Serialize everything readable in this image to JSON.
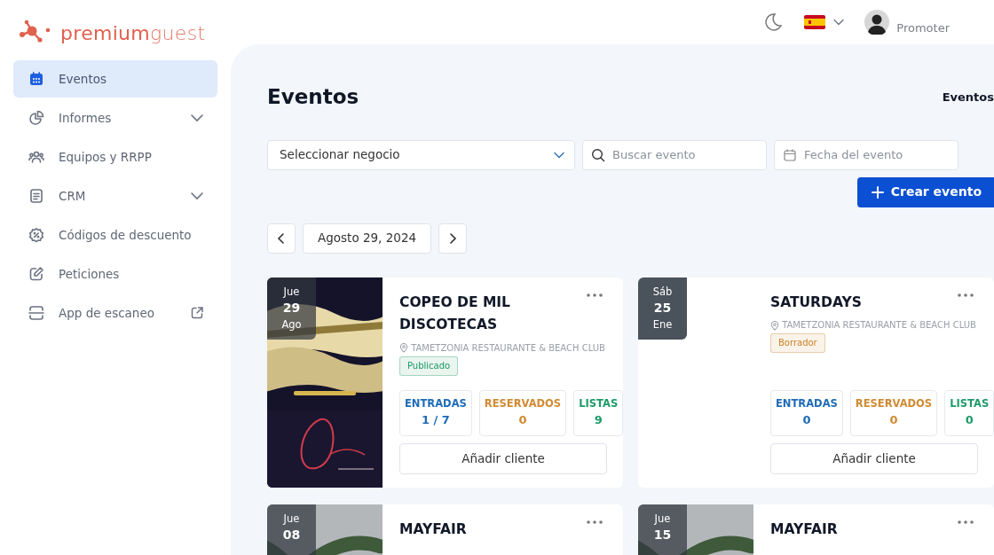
{
  "brand": {
    "name_bold": "premium",
    "name_light": "guest"
  },
  "sidebar": {
    "items": [
      {
        "label": "Eventos",
        "selected": true,
        "has_submenu": false,
        "external": false
      },
      {
        "label": "Informes",
        "selected": false,
        "has_submenu": true,
        "external": false
      },
      {
        "label": "Equipos y RRPP",
        "selected": false,
        "has_submenu": false,
        "external": false
      },
      {
        "label": "CRM",
        "selected": false,
        "has_submenu": true,
        "external": false
      },
      {
        "label": "Códigos de descuento",
        "selected": false,
        "has_submenu": false,
        "external": false
      },
      {
        "label": "Peticiones",
        "selected": false,
        "has_submenu": false,
        "external": false
      },
      {
        "label": "App de escaneo",
        "selected": false,
        "has_submenu": false,
        "external": true
      }
    ]
  },
  "header": {
    "role": "Promoter"
  },
  "page": {
    "title": "Eventos",
    "breadcrumb": "Eventos"
  },
  "filters": {
    "business_select": "Seleccionar negocio",
    "search": {
      "placeholder": "Buscar evento"
    },
    "date": {
      "placeholder": "Fecha del evento"
    }
  },
  "create_button": "Crear evento",
  "date_nav": {
    "date": "Agosto 29, 2024"
  },
  "events": [
    {
      "day_name": "Jue",
      "day": "29",
      "month": "Ago",
      "has_picture": true,
      "title": "COPEO DE MIL DISCOTECAS",
      "venue": "TAMETZONIA RESTAURANTE & BEACH CLUB",
      "status": "Publicado",
      "color": "#1b9a63",
      "stats": [
        {
          "label": "ENTRADAS",
          "value": "1 / 7",
          "kind": "tickets"
        },
        {
          "label": "RESERVADOS",
          "value": "0",
          "kind": "reserved"
        },
        {
          "label": "LISTAS",
          "value": "9",
          "kind": "lists"
        }
      ],
      "action": "Añadir cliente"
    },
    {
      "day_name": "Sáb",
      "day": "25",
      "month": "Ene",
      "has_picture": false,
      "title": "SATURDAYS",
      "venue": "TAMETZONIA RESTAURANTE & BEACH CLUB",
      "status": "Borrador",
      "color": "#cc7f23",
      "stats": [
        {
          "label": "ENTRADAS",
          "value": "0",
          "kind": "tickets"
        },
        {
          "label": "RESERVADOS",
          "value": "0",
          "kind": "reserved"
        },
        {
          "label": "LISTAS",
          "value": "0",
          "kind": "lists"
        }
      ],
      "action": "Añadir cliente"
    },
    {
      "day_name": "Jue",
      "day": "08",
      "has_picture": true,
      "title": "MAYFAIR"
    },
    {
      "day_name": "Jue",
      "day": "15",
      "has_picture": true,
      "title": "MAYFAIR"
    }
  ]
}
